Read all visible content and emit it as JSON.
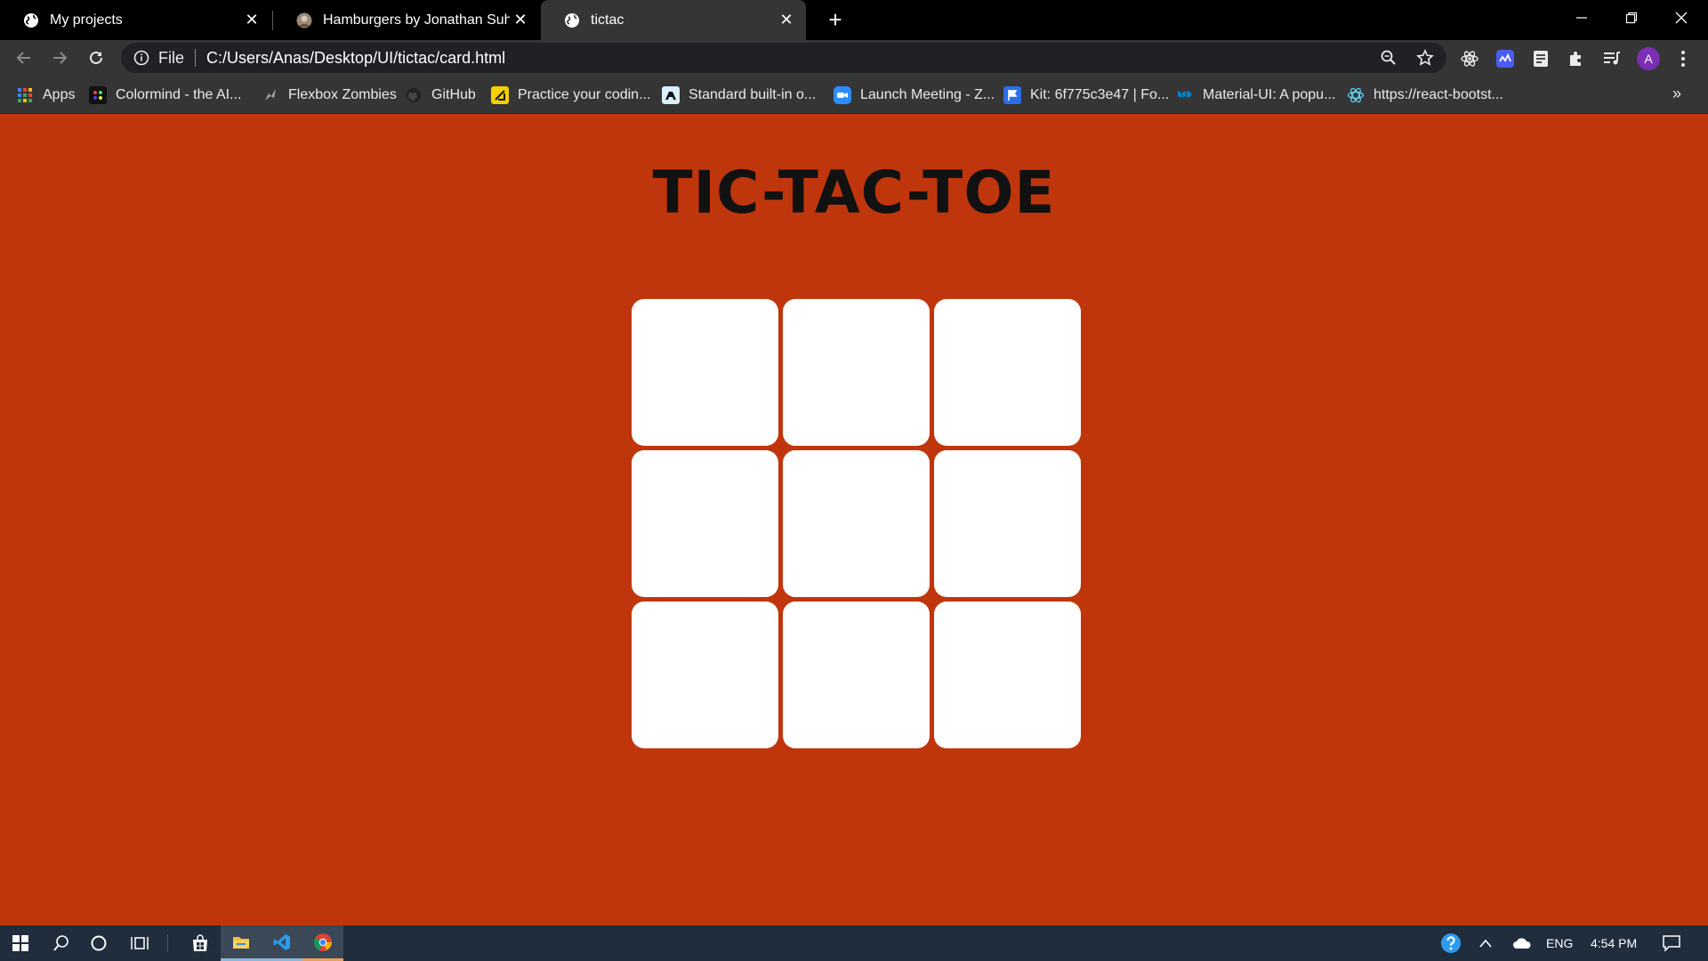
{
  "browser": {
    "tabs": [
      {
        "title": "My projects",
        "icon": "globe-icon"
      },
      {
        "title": "Hamburgers by Jonathan Suh",
        "icon": "profile-photo-icon"
      },
      {
        "title": "tictac",
        "icon": "globe-icon",
        "active": true
      }
    ],
    "new_tab_label": "+",
    "address": {
      "scheme": "File",
      "url": "C:/Users/Anas/Desktop/UI/tictac/card.html"
    },
    "profile_initial": "A",
    "bookmarks": [
      {
        "label": "Apps",
        "icon": "apps-grid-icon"
      },
      {
        "label": "Colormind - the AI...",
        "icon": "colormind-icon"
      },
      {
        "label": "Flexbox Zombies",
        "icon": "zombie-icon"
      },
      {
        "label": "GitHub",
        "icon": "github-icon"
      },
      {
        "label": "Practice your codin...",
        "icon": "codewars-icon"
      },
      {
        "label": "Standard built-in o...",
        "icon": "mdn-icon"
      },
      {
        "label": "Launch Meeting - Z...",
        "icon": "zoom-icon"
      },
      {
        "label": "Kit: 6f775c3e47 | Fo...",
        "icon": "fontawesome-flag-icon"
      },
      {
        "label": "Material-UI: A popu...",
        "icon": "material-ui-icon"
      },
      {
        "label": "https://react-bootst...",
        "icon": "react-bootstrap-icon"
      }
    ],
    "bookmarks_overflow": "»"
  },
  "page": {
    "title": "TIC-TAC-TOE",
    "board_cells": [
      "",
      "",
      "",
      "",
      "",
      "",
      "",
      "",
      ""
    ]
  },
  "taskbar": {
    "language": "ENG",
    "time": "4:54 PM"
  },
  "colors": {
    "page_background": "#c0360c",
    "cell_background": "#ffffff",
    "title_color": "#111111",
    "chrome_dark": "#000000",
    "toolbar": "#353535",
    "taskbar": "#1f2d3d"
  }
}
